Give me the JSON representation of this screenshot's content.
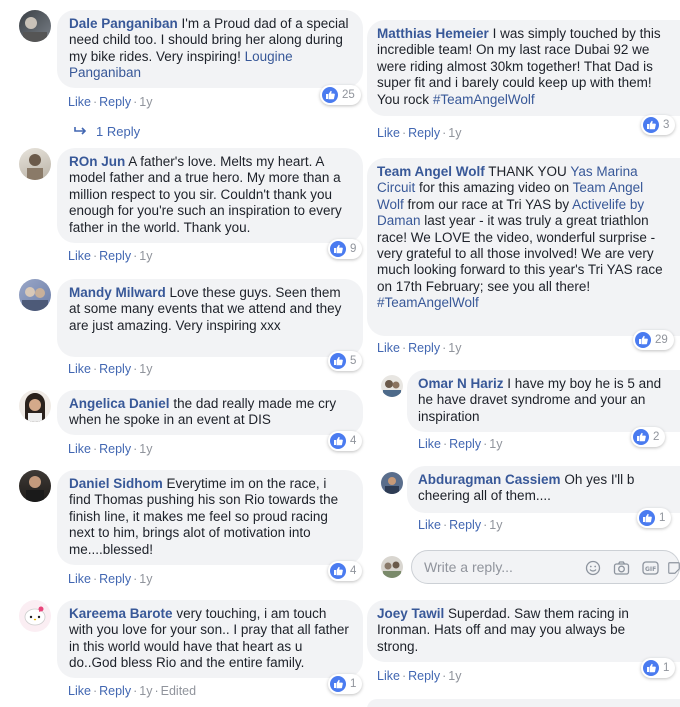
{
  "left": {
    "c1": {
      "author": "Dale Panganiban",
      "text": "I'm a Proud dad of a special need child too. I should bring her along during my bike rides. Very inspiring!",
      "mention": "Lougine Panganiban",
      "like": "Like",
      "reply": "Reply",
      "time": "1y",
      "reactions": "25",
      "replies_link": "1 Reply"
    },
    "c2": {
      "author": "ROn Jun",
      "text": "A father's love. Melts my heart. A model father and a true hero. My more than a million respect to you sir. Couldn't thank you enough for you're such an inspiration to every father in the world. Thank you.",
      "like": "Like",
      "reply": "Reply",
      "time": "1y",
      "reactions": "9"
    },
    "c3": {
      "author": "Mandy Milward",
      "text": "Love these guys. Seen them at some many events that we attend and they are just amazing. Very inspiring xxx",
      "like": "Like",
      "reply": "Reply",
      "time": "1y",
      "reactions": "5"
    },
    "c4": {
      "author": "Angelica Daniel",
      "text": "the dad really made me cry when he spoke in an event at DIS",
      "like": "Like",
      "reply": "Reply",
      "time": "1y",
      "reactions": "4"
    },
    "c5": {
      "author": "Daniel Sidhom",
      "text": "Everytime im on the race, i find Thomas pushing his son Rio towards the finish line, it makes me feel so proud racing next to him, brings alot of motivation into me....blessed!",
      "like": "Like",
      "reply": "Reply",
      "time": "1y",
      "reactions": "4"
    },
    "c6": {
      "author": "Kareema Barote",
      "text": "very touching, i am touch with you love for your son.. I pray that all father in this world would have that heart as u do..God bless Rio and the entire family.",
      "like": "Like",
      "reply": "Reply",
      "time": "1y",
      "edited": "Edited",
      "reactions": "1"
    }
  },
  "right": {
    "c1": {
      "author": "Matthias Hemeier",
      "text": "I was simply touched by this incredible team! On my last race Dubai 92 we were riding almost 30km together! That Dad is super fit and i barely could keep up with them! You rock",
      "hashtag": "#TeamAngelWolf",
      "like": "Like",
      "reply": "Reply",
      "time": "1y",
      "reactions": "3"
    },
    "c2": {
      "author": "Team Angel Wolf",
      "t1": "THANK YOU",
      "m1": "Yas Marina Circuit",
      "t2": "for this amazing video on",
      "m2": "Team Angel Wolf",
      "t3": "from our race at Tri YAS by",
      "m3": "Activelife by Daman",
      "t4": "last year - it was truly a great triathlon race! We LOVE the video, wonderful surprise - very grateful to all those involved! We are very much looking forward to this year's Tri YAS race on 17th February; see you all there!",
      "hashtag": "#TeamAngelWolf",
      "like": "Like",
      "reply": "Reply",
      "time": "1y",
      "reactions": "29"
    },
    "c3": {
      "author": "Omar N Hariz",
      "text": "I have my boy he is 5 and he have dravet syndrome and your an inspiration",
      "like": "Like",
      "reply": "Reply",
      "time": "1y",
      "reactions": "2"
    },
    "c4": {
      "author": "Abduragman Cassiem",
      "text": "Oh yes I'll b cheering all of them....",
      "like": "Like",
      "reply": "Reply",
      "time": "1y",
      "reactions": "1"
    },
    "reply_box": {
      "placeholder": "Write a reply..."
    },
    "c5": {
      "author": "Joey Tawil",
      "text": "Superdad. Saw them racing in Ironman. Hats off and may you always be strong.",
      "like": "Like",
      "reply": "Reply",
      "time": "1y",
      "reactions": "1"
    }
  },
  "colors": {
    "link": "#385898",
    "action": "#4267b2",
    "bubble": "#f2f3f5",
    "like_badge": "#4a7bf0",
    "meta": "#90949c"
  },
  "icons": [
    "thumbs-up-icon",
    "reply-arrow-icon",
    "emoji-icon",
    "camera-icon",
    "gif-icon",
    "sticker-icon"
  ]
}
